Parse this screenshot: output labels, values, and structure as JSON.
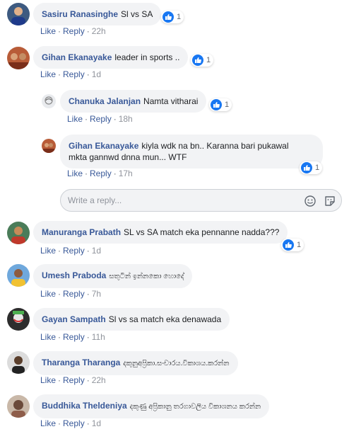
{
  "actions": {
    "like": "Like",
    "reply": "Reply",
    "dot": "·"
  },
  "comments": [
    {
      "name": "Sasiru Ranasinghe",
      "text": "Sl vs SA",
      "time": "22h",
      "reactions": "1"
    },
    {
      "name": "Gihan Ekanayake",
      "text": "leader in sports ..",
      "time": "1d",
      "reactions": "1"
    },
    {
      "name": "Chanuka Jalanjan",
      "text": "Namta vitharai",
      "time": "18h",
      "reactions": "1"
    },
    {
      "name": "Gihan Ekanayake",
      "text": "kiyla wdk na bn.. Karanna bari pukawal",
      "text2": "mkta gannwd dnna mun... WTF",
      "time": "17h",
      "reactions": "1"
    },
    {
      "name": "Manuranga Prabath",
      "text": "SL vs SA match eka pennanne nadda???",
      "time": "1d",
      "reactions": "1"
    },
    {
      "name": "Umesh Praboda",
      "text": "සතුටින් ඉන්නකො හොදේ",
      "time": "7h"
    },
    {
      "name": "Gayan Sampath",
      "text": "Sl vs sa match eka denawada",
      "time": "11h"
    },
    {
      "name": "Tharanga Tharanga",
      "text": "දකුනුඅප්‍රිකා.සංචාරය.විකාශය.කරන්න",
      "time": "22h"
    },
    {
      "name": "Buddhika Theldeniya",
      "text": "දකුණු අප්‍රිකානු තරගාවලිය විකාශනය කරන්න",
      "time": "1d"
    }
  ],
  "reply_box": {
    "placeholder": "Write a reply..."
  },
  "colors": {
    "name": "#385898",
    "bubble": "#f2f3f5",
    "like_badge": "#1877f2",
    "meta": "#90949c"
  }
}
